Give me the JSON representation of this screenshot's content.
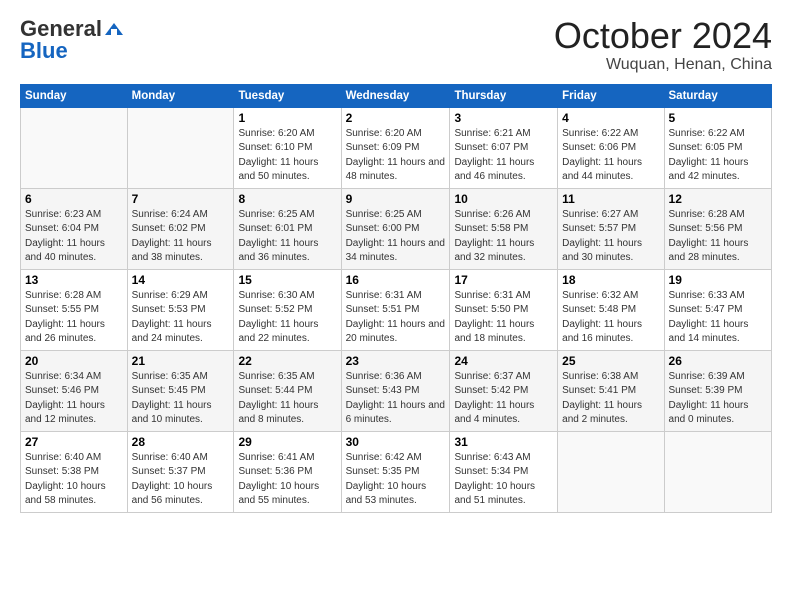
{
  "header": {
    "logo_general": "General",
    "logo_blue": "Blue",
    "month_title": "October 2024",
    "location": "Wuquan, Henan, China"
  },
  "weekdays": [
    "Sunday",
    "Monday",
    "Tuesday",
    "Wednesday",
    "Thursday",
    "Friday",
    "Saturday"
  ],
  "weeks": [
    [
      {
        "day": "",
        "info": ""
      },
      {
        "day": "",
        "info": ""
      },
      {
        "day": "1",
        "info": "Sunrise: 6:20 AM\nSunset: 6:10 PM\nDaylight: 11 hours and 50 minutes."
      },
      {
        "day": "2",
        "info": "Sunrise: 6:20 AM\nSunset: 6:09 PM\nDaylight: 11 hours and 48 minutes."
      },
      {
        "day": "3",
        "info": "Sunrise: 6:21 AM\nSunset: 6:07 PM\nDaylight: 11 hours and 46 minutes."
      },
      {
        "day": "4",
        "info": "Sunrise: 6:22 AM\nSunset: 6:06 PM\nDaylight: 11 hours and 44 minutes."
      },
      {
        "day": "5",
        "info": "Sunrise: 6:22 AM\nSunset: 6:05 PM\nDaylight: 11 hours and 42 minutes."
      }
    ],
    [
      {
        "day": "6",
        "info": "Sunrise: 6:23 AM\nSunset: 6:04 PM\nDaylight: 11 hours and 40 minutes."
      },
      {
        "day": "7",
        "info": "Sunrise: 6:24 AM\nSunset: 6:02 PM\nDaylight: 11 hours and 38 minutes."
      },
      {
        "day": "8",
        "info": "Sunrise: 6:25 AM\nSunset: 6:01 PM\nDaylight: 11 hours and 36 minutes."
      },
      {
        "day": "9",
        "info": "Sunrise: 6:25 AM\nSunset: 6:00 PM\nDaylight: 11 hours and 34 minutes."
      },
      {
        "day": "10",
        "info": "Sunrise: 6:26 AM\nSunset: 5:58 PM\nDaylight: 11 hours and 32 minutes."
      },
      {
        "day": "11",
        "info": "Sunrise: 6:27 AM\nSunset: 5:57 PM\nDaylight: 11 hours and 30 minutes."
      },
      {
        "day": "12",
        "info": "Sunrise: 6:28 AM\nSunset: 5:56 PM\nDaylight: 11 hours and 28 minutes."
      }
    ],
    [
      {
        "day": "13",
        "info": "Sunrise: 6:28 AM\nSunset: 5:55 PM\nDaylight: 11 hours and 26 minutes."
      },
      {
        "day": "14",
        "info": "Sunrise: 6:29 AM\nSunset: 5:53 PM\nDaylight: 11 hours and 24 minutes."
      },
      {
        "day": "15",
        "info": "Sunrise: 6:30 AM\nSunset: 5:52 PM\nDaylight: 11 hours and 22 minutes."
      },
      {
        "day": "16",
        "info": "Sunrise: 6:31 AM\nSunset: 5:51 PM\nDaylight: 11 hours and 20 minutes."
      },
      {
        "day": "17",
        "info": "Sunrise: 6:31 AM\nSunset: 5:50 PM\nDaylight: 11 hours and 18 minutes."
      },
      {
        "day": "18",
        "info": "Sunrise: 6:32 AM\nSunset: 5:48 PM\nDaylight: 11 hours and 16 minutes."
      },
      {
        "day": "19",
        "info": "Sunrise: 6:33 AM\nSunset: 5:47 PM\nDaylight: 11 hours and 14 minutes."
      }
    ],
    [
      {
        "day": "20",
        "info": "Sunrise: 6:34 AM\nSunset: 5:46 PM\nDaylight: 11 hours and 12 minutes."
      },
      {
        "day": "21",
        "info": "Sunrise: 6:35 AM\nSunset: 5:45 PM\nDaylight: 11 hours and 10 minutes."
      },
      {
        "day": "22",
        "info": "Sunrise: 6:35 AM\nSunset: 5:44 PM\nDaylight: 11 hours and 8 minutes."
      },
      {
        "day": "23",
        "info": "Sunrise: 6:36 AM\nSunset: 5:43 PM\nDaylight: 11 hours and 6 minutes."
      },
      {
        "day": "24",
        "info": "Sunrise: 6:37 AM\nSunset: 5:42 PM\nDaylight: 11 hours and 4 minutes."
      },
      {
        "day": "25",
        "info": "Sunrise: 6:38 AM\nSunset: 5:41 PM\nDaylight: 11 hours and 2 minutes."
      },
      {
        "day": "26",
        "info": "Sunrise: 6:39 AM\nSunset: 5:39 PM\nDaylight: 11 hours and 0 minutes."
      }
    ],
    [
      {
        "day": "27",
        "info": "Sunrise: 6:40 AM\nSunset: 5:38 PM\nDaylight: 10 hours and 58 minutes."
      },
      {
        "day": "28",
        "info": "Sunrise: 6:40 AM\nSunset: 5:37 PM\nDaylight: 10 hours and 56 minutes."
      },
      {
        "day": "29",
        "info": "Sunrise: 6:41 AM\nSunset: 5:36 PM\nDaylight: 10 hours and 55 minutes."
      },
      {
        "day": "30",
        "info": "Sunrise: 6:42 AM\nSunset: 5:35 PM\nDaylight: 10 hours and 53 minutes."
      },
      {
        "day": "31",
        "info": "Sunrise: 6:43 AM\nSunset: 5:34 PM\nDaylight: 10 hours and 51 minutes."
      },
      {
        "day": "",
        "info": ""
      },
      {
        "day": "",
        "info": ""
      }
    ]
  ]
}
